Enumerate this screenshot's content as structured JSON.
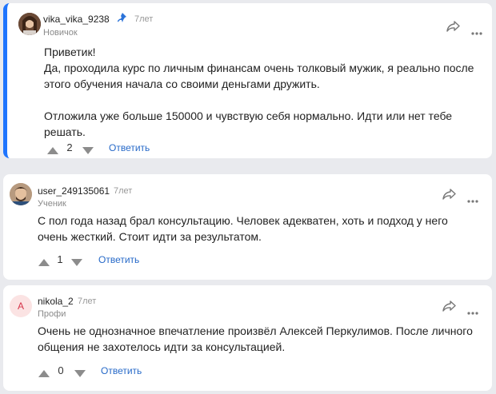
{
  "comments": [
    {
      "username": "vika_vika_9238",
      "age": "7лет",
      "rank": "Новичок",
      "paragraphs": [
        "Приветик!",
        "Да, проходила курс по личным финансам очень толковый мужик, я реально после этого обучения начала со своими деньгами дружить.",
        "Отложила уже больше 150000 и чувствую себя нормально. Идти или нет тебе решать."
      ],
      "score": "2",
      "reply_label": "Ответить"
    },
    {
      "username": "user_249135061",
      "age": "7лет",
      "rank": "Ученик",
      "paragraphs": [
        "С пол года назад брал консультацию. Человек адекватен, хоть и подход у него очень жесткий. Стоит идти за результатом."
      ],
      "score": "1",
      "reply_label": "Ответить"
    },
    {
      "username": "nikola_2",
      "age": "7лет",
      "rank": "Профи",
      "avatar_letter": "А",
      "paragraphs": [
        "Очень не однозначное впечатление произвёл Алексей Перкулимов. После личного общения не захотелось идти за консультацией."
      ],
      "score": "0",
      "reply_label": "Ответить"
    }
  ],
  "colors": {
    "accent": "#1f75fe",
    "link": "#2669c8",
    "background": "#e9eaee"
  }
}
